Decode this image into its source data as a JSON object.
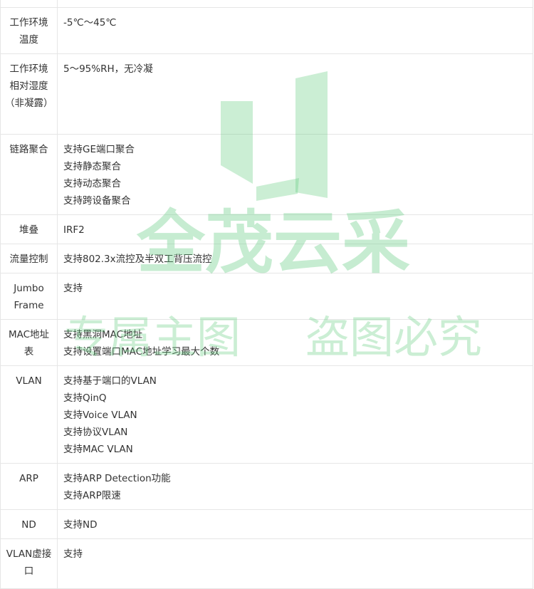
{
  "spec_rows": [
    {
      "label": "",
      "values": [],
      "height": 11
    },
    {
      "label": "工作环境温度",
      "values": [
        "-5℃～45℃"
      ],
      "height": 65
    },
    {
      "label": "工作环境相对湿度（非凝露）",
      "values": [
        "5～95%RH，无冷凝"
      ],
      "height": 113
    },
    {
      "label": "链路聚合",
      "values": [
        "支持GE端口聚合",
        "支持静态聚合",
        "支持动态聚合",
        "支持跨设备聚合"
      ],
      "height": 113
    },
    {
      "label": "堆叠",
      "values": [
        "IRF2"
      ],
      "height": 41
    },
    {
      "label": "流量控制",
      "values": [
        "支持802.3x流控及半双工背压流控"
      ],
      "height": 41
    },
    {
      "label": "Jumbo Frame",
      "values": [
        "支持"
      ],
      "height": 65
    },
    {
      "label": "MAC地址表",
      "values": [
        "支持黑洞MAC地址",
        "支持设置端口MAC地址学习最大个数"
      ],
      "height": 65
    },
    {
      "label": "VLAN",
      "values": [
        "支持基于端口的VLAN",
        "支持QinQ",
        "支持Voice VLAN",
        "支持协议VLAN",
        "支持MAC VLAN"
      ],
      "height": 137
    },
    {
      "label": "ARP",
      "values": [
        "支持ARP Detection功能",
        "支持ARP限速"
      ],
      "height": 65
    },
    {
      "label": "ND",
      "values": [
        "支持ND"
      ],
      "height": 41
    },
    {
      "label": "VLAN虚接口",
      "values": [
        "支持"
      ],
      "height": 70
    }
  ],
  "watermark": {
    "line1": "全茂云采",
    "line2_left": "专属主图",
    "line2_right": "盗图必究",
    "color": "#5cc97a"
  }
}
